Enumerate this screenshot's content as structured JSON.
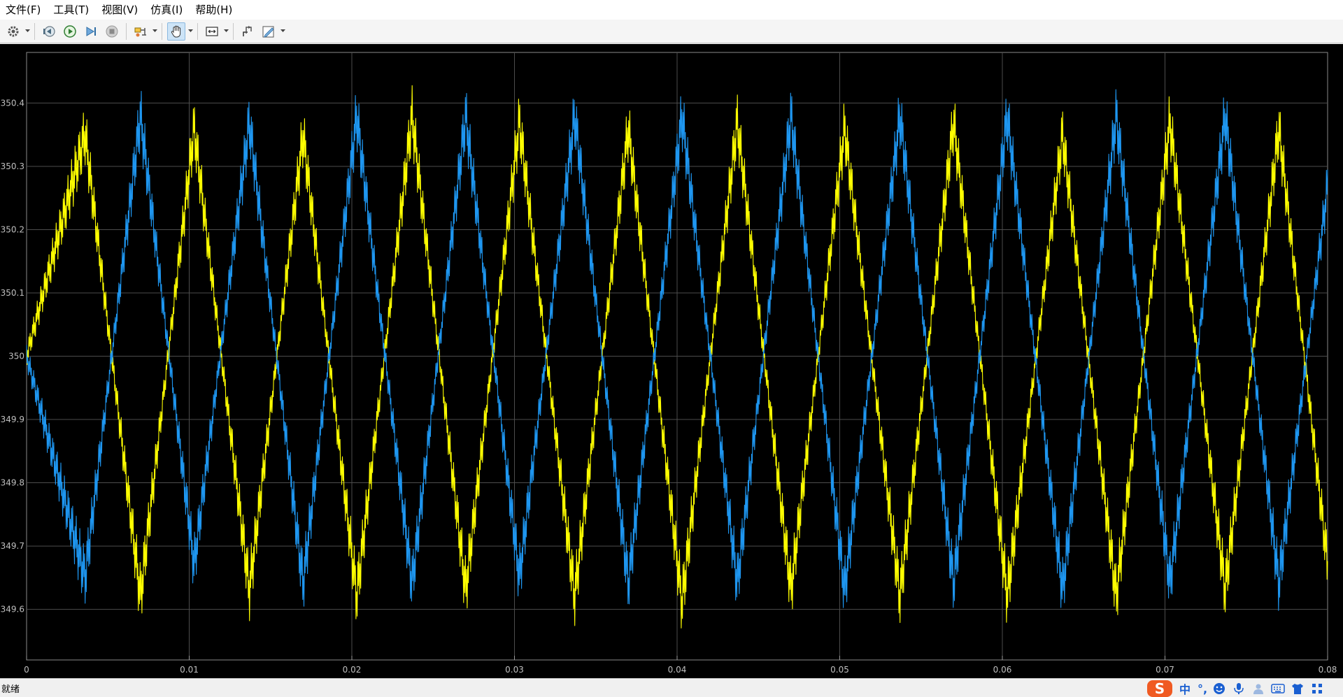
{
  "menu": {
    "file": "文件(F)",
    "tools": "工具(T)",
    "view": "视图(V)",
    "simulation": "仿真(I)",
    "help": "帮助(H)"
  },
  "toolbar": {
    "icons": [
      "gear-icon",
      "step-back-icon",
      "run-icon",
      "step-forward-icon",
      "stop-icon",
      "signal-select-icon",
      "pan-icon",
      "zoom-fit-icon",
      "restore-icon",
      "edit-style-icon"
    ],
    "active": "pan-icon"
  },
  "status": {
    "text": "就绪"
  },
  "ime": {
    "logo": "S",
    "mode": "中",
    "punct": "°,"
  },
  "colors": {
    "plot_background": "#000000",
    "grid": "#4d4d4d",
    "axis_text": "#bfbfbf",
    "series_yellow": "#ffff00",
    "series_blue": "#1e96f0"
  },
  "chart_data": {
    "type": "line",
    "xlim": [
      0,
      0.08
    ],
    "ylim": [
      349.52,
      350.48
    ],
    "xticks": [
      0,
      0.01,
      0.02,
      0.03,
      0.04,
      0.05,
      0.06,
      0.07,
      0.08
    ],
    "xtick_labels": [
      "0",
      "0.01",
      "0.02",
      "0.03",
      "0.04",
      "0.05",
      "0.06",
      "0.07",
      "0.08"
    ],
    "yticks": [
      349.6,
      349.7,
      349.8,
      349.9,
      350,
      350.1,
      350.2,
      350.3,
      350.4
    ],
    "ytick_labels": [
      "349.6",
      "349.7",
      "349.8",
      "349.9",
      "350",
      "350.1",
      "350.2",
      "350.3",
      "350.4"
    ],
    "grid": true,
    "series": [
      {
        "color": "#ffff00",
        "peaks": [
          [
            0.0036,
            350.35
          ],
          [
            0.0103,
            350.36
          ],
          [
            0.017,
            350.35
          ],
          [
            0.0237,
            350.38
          ],
          [
            0.0303,
            350.37
          ],
          [
            0.037,
            350.36
          ],
          [
            0.0437,
            350.37
          ],
          [
            0.0503,
            350.36
          ],
          [
            0.057,
            350.37
          ],
          [
            0.0637,
            350.35
          ],
          [
            0.0703,
            350.37
          ],
          [
            0.077,
            350.36
          ]
        ],
        "troughs": [
          [
            0.007,
            349.62
          ],
          [
            0.0137,
            349.63
          ],
          [
            0.0203,
            349.62
          ],
          [
            0.027,
            349.63
          ],
          [
            0.0337,
            349.62
          ],
          [
            0.0403,
            349.61
          ],
          [
            0.047,
            349.63
          ],
          [
            0.0537,
            349.62
          ],
          [
            0.0603,
            349.62
          ],
          [
            0.067,
            349.62
          ],
          [
            0.0737,
            349.63
          ],
          [
            0.08,
            349.67
          ]
        ]
      },
      {
        "color": "#1e96f0",
        "peaks": [
          [
            0.007,
            350.38
          ],
          [
            0.0137,
            350.37
          ],
          [
            0.0203,
            350.38
          ],
          [
            0.027,
            350.38
          ],
          [
            0.0337,
            350.38
          ],
          [
            0.0403,
            350.38
          ],
          [
            0.047,
            350.38
          ],
          [
            0.0537,
            350.38
          ],
          [
            0.0603,
            350.38
          ],
          [
            0.067,
            350.38
          ],
          [
            0.0737,
            350.38
          ],
          [
            0.08,
            350.27
          ]
        ],
        "troughs": [
          [
            0.0036,
            349.65
          ],
          [
            0.0103,
            349.67
          ],
          [
            0.017,
            349.64
          ],
          [
            0.0237,
            349.64
          ],
          [
            0.0303,
            349.65
          ],
          [
            0.037,
            349.64
          ],
          [
            0.0437,
            349.64
          ],
          [
            0.0503,
            349.63
          ],
          [
            0.057,
            349.64
          ],
          [
            0.0637,
            349.63
          ],
          [
            0.0703,
            349.64
          ],
          [
            0.077,
            349.64
          ]
        ]
      }
    ]
  }
}
